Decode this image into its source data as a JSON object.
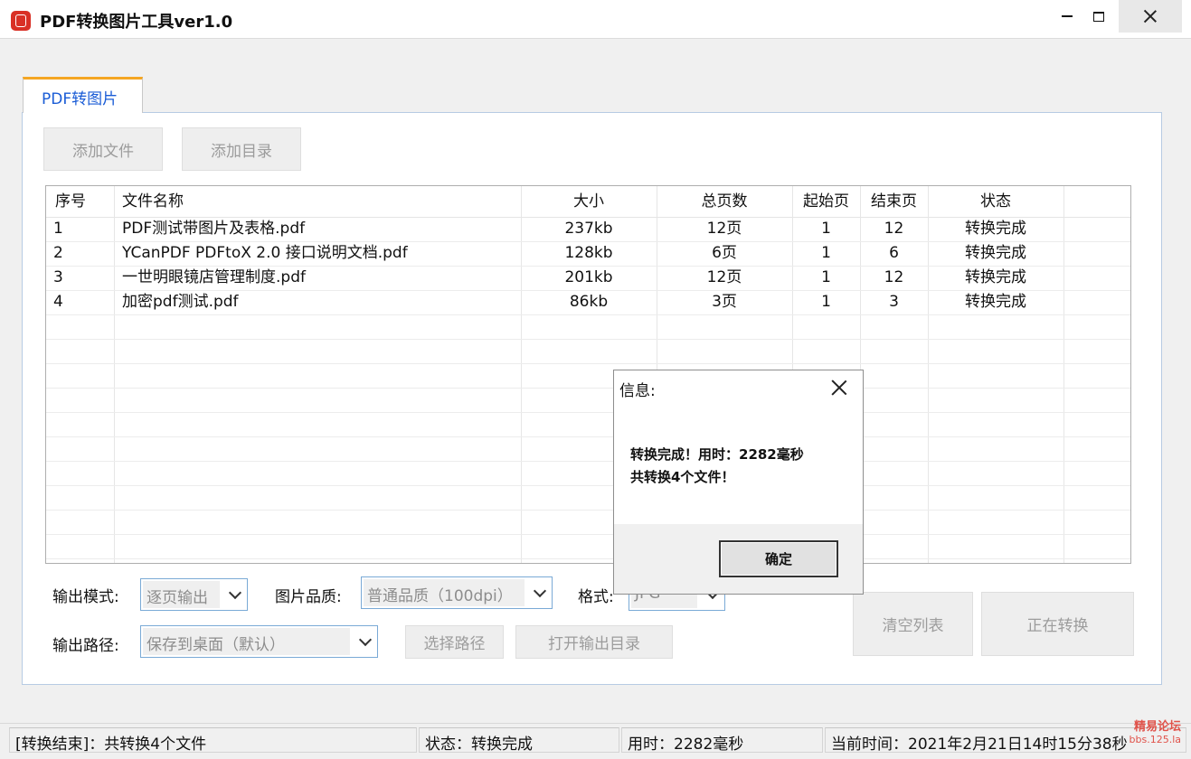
{
  "window": {
    "title": "PDF转换图片工具ver1.0",
    "controls": {
      "minimize": "minimize-icon",
      "maximize": "maximize-icon",
      "close": "close-icon"
    }
  },
  "tabs": [
    {
      "label": "PDF转图片",
      "active": true
    }
  ],
  "toolbar": {
    "add_file_label": "添加文件",
    "add_dir_label": "添加目录"
  },
  "table": {
    "columns": [
      "序号",
      "文件名称",
      "大小",
      "总页数",
      "起始页",
      "结束页",
      "状态"
    ],
    "rows": [
      [
        "1",
        "PDF测试带图片及表格.pdf",
        "237kb",
        "12页",
        "1",
        "12",
        "转换完成"
      ],
      [
        "2",
        "YCanPDF PDFtoX 2.0 接口说明文档.pdf",
        "128kb",
        "6页",
        "1",
        "6",
        "转换完成"
      ],
      [
        "3",
        "一世明眼镜店管理制度.pdf",
        "201kb",
        "12页",
        "1",
        "12",
        "转换完成"
      ],
      [
        "4",
        "加密pdf测试.pdf",
        "86kb",
        "3页",
        "1",
        "3",
        "转换完成"
      ]
    ]
  },
  "form": {
    "output_mode_label": "输出模式:",
    "output_mode_value": "逐页输出",
    "quality_label": "图片品质:",
    "quality_value": "普通品质（100dpi）",
    "format_label": "格式:",
    "format_value": "JPG",
    "output_path_label": "输出路径:",
    "output_path_value": "保存到桌面（默认）",
    "choose_path_label": "选择路径",
    "open_dir_label": "打开输出目录",
    "clear_label": "清空列表",
    "converting_label": "正在转换"
  },
  "statusbar": {
    "panel1": "[转换结束]：共转换4个文件",
    "panel2": "状态：转换完成",
    "panel3": "用时：2282毫秒",
    "panel4": "当前时间：2021年2月21日14时15分38秒"
  },
  "dialog": {
    "title": "信息:",
    "line1": "转换完成！用时：2282毫秒",
    "line2": "共转换4个文件！",
    "ok_label": "确定"
  },
  "watermark": {
    "line1": "精易论坛",
    "line2": "bbs.125.la"
  },
  "colors": {
    "tab_accent": "#f5a623",
    "tab_text": "#1a5cd6",
    "app_icon": "#d93025",
    "watermark": "#e0524a"
  }
}
